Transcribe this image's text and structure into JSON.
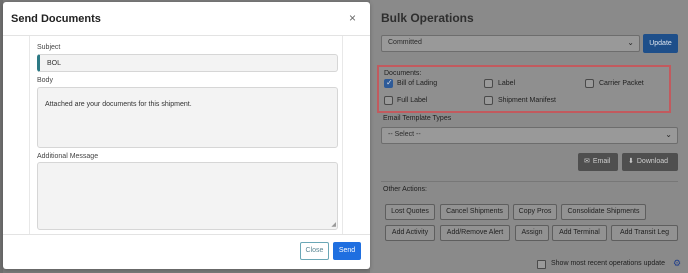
{
  "modal": {
    "title": "Send Documents",
    "close_icon": "×",
    "subject_label": "Subject",
    "subject_value": "BOL",
    "body_label": "Body",
    "body_value": "Attached are your documents for this shipment.",
    "additional_label": "Additional Message",
    "additional_value": "",
    "close_button": "Close",
    "send_button": "Send"
  },
  "bulk": {
    "title": "Bulk Operations",
    "status_select": "Committed",
    "update_button": "Update",
    "documents_label": "Documents:",
    "documents": [
      {
        "label": "Bill of Lading",
        "checked": true
      },
      {
        "label": "Label",
        "checked": false
      },
      {
        "label": "Carrier Packet",
        "checked": false
      },
      {
        "label": "Full Label",
        "checked": false
      },
      {
        "label": "Shipment Manifest",
        "checked": false
      }
    ],
    "email_template_label": "Email Template Types",
    "email_template_select": "-- Select --",
    "email_button": "Email",
    "download_button": "Download",
    "other_actions_label": "Other Actions:",
    "actions": [
      "Lost Quotes",
      "Cancel Shipments",
      "Copy Pros",
      "Consolidate Shipments",
      "Add Activity",
      "Add/Remove Alert",
      "Assign",
      "Add Terminal",
      "Add Transit Leg"
    ],
    "recent_label": "Show most recent operations update"
  },
  "icons": {
    "chevron": "chevron-down-icon",
    "email": "envelope-icon",
    "download": "download-icon",
    "gear": "gear-icon"
  },
  "colors": {
    "primary": "#1f6fe0",
    "highlight_border": "#c25a5e",
    "accent": "#2d7a85"
  }
}
